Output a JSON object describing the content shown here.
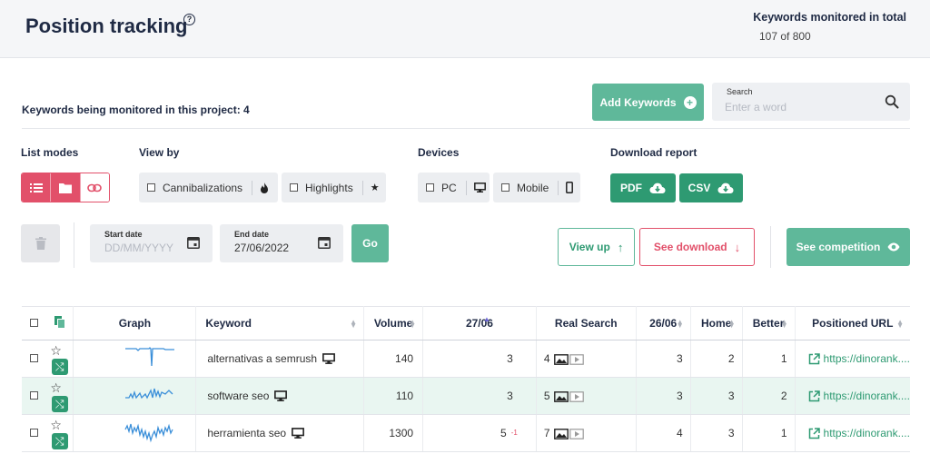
{
  "header": {
    "title": "Position tracking",
    "kw_total_label": "Keywords monitored in total",
    "kw_total_value": "107 of 800"
  },
  "project": {
    "monitored_text": "Keywords being monitored in this project: 4"
  },
  "actions": {
    "add_keywords": "Add Keywords"
  },
  "search": {
    "label": "Search",
    "placeholder": "Enter a word"
  },
  "sections": {
    "list_modes": "List modes",
    "view_by": "View by",
    "devices": "Devices",
    "download_report": "Download report"
  },
  "view_by": {
    "cannibalizations": "Cannibalizations",
    "highlights": "Highlights"
  },
  "devices": {
    "pc": "PC",
    "mobile": "Mobile"
  },
  "download": {
    "pdf": "PDF",
    "csv": "CSV"
  },
  "dates": {
    "start_label": "Start date",
    "start_placeholder": "DD/MM/YYYY",
    "end_label": "End date",
    "end_value": "27/06/2022",
    "go": "Go"
  },
  "buttons": {
    "view_up": "View up",
    "see_download": "See download",
    "see_competition": "See competition"
  },
  "colors": {
    "accent_green": "#5fb89a",
    "dark_green": "#2e9a72",
    "accent_red": "#e2506a",
    "sparkline_blue": "#3b8fd9"
  },
  "table": {
    "headers": {
      "graph": "Graph",
      "keyword": "Keyword",
      "volume": "Volume",
      "date_current": "27/06",
      "real_search": "Real Search",
      "date_prev": "26/06",
      "home": "Home",
      "better": "Better",
      "positioned_url": "Positioned URL"
    },
    "rows": [
      {
        "keyword": "alternativas a semrush",
        "volume": "140",
        "pos_current": "3",
        "delta": "",
        "real_search": "4",
        "pos_prev": "3",
        "home": "2",
        "better": "1",
        "url": "https://dinorank....",
        "highlighted": false
      },
      {
        "keyword": "software seo",
        "volume": "110",
        "pos_current": "3",
        "delta": "",
        "real_search": "5",
        "pos_prev": "3",
        "home": "3",
        "better": "2",
        "url": "https://dinorank....",
        "highlighted": true
      },
      {
        "keyword": "herramienta seo",
        "volume": "1300",
        "pos_current": "5",
        "delta": "-1",
        "real_search": "7",
        "pos_prev": "4",
        "home": "3",
        "better": "1",
        "url": "https://dinorank....",
        "highlighted": false
      }
    ]
  }
}
